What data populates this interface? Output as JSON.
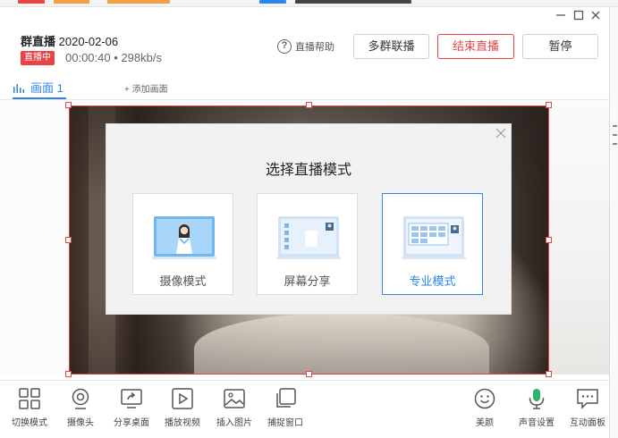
{
  "header": {
    "title": "群直播",
    "date": "2020-02-06",
    "live_badge": "直播中",
    "duration": "00:00:40",
    "bitrate": "298kb/s",
    "help_label": "直播帮助",
    "multi_group_button": "多群联播",
    "end_button": "结束直播",
    "pause_button": "暂停"
  },
  "tabs": {
    "active_label": "画面 1",
    "add_label": "添加画面"
  },
  "modal": {
    "title": "选择直播模式",
    "options": [
      {
        "label": "摄像模式",
        "selected": false
      },
      {
        "label": "屏幕分享",
        "selected": false
      },
      {
        "label": "专业模式",
        "selected": true
      }
    ]
  },
  "toolbar": {
    "left": [
      {
        "label": "切换模式",
        "icon": "grid-icon"
      },
      {
        "label": "摄像头",
        "icon": "camera-icon"
      },
      {
        "label": "分享桌面",
        "icon": "share-desktop-icon"
      },
      {
        "label": "播放视频",
        "icon": "play-video-icon"
      },
      {
        "label": "插入图片",
        "icon": "image-icon"
      },
      {
        "label": "捕捉窗口",
        "icon": "capture-window-icon"
      }
    ],
    "right": [
      {
        "label": "美颜",
        "icon": "smile-icon"
      },
      {
        "label": "声音设置",
        "icon": "microphone-icon"
      },
      {
        "label": "互动面板",
        "icon": "chat-icon"
      }
    ]
  },
  "colors": {
    "accent": "#2b86e8",
    "live_red": "#e84444"
  }
}
